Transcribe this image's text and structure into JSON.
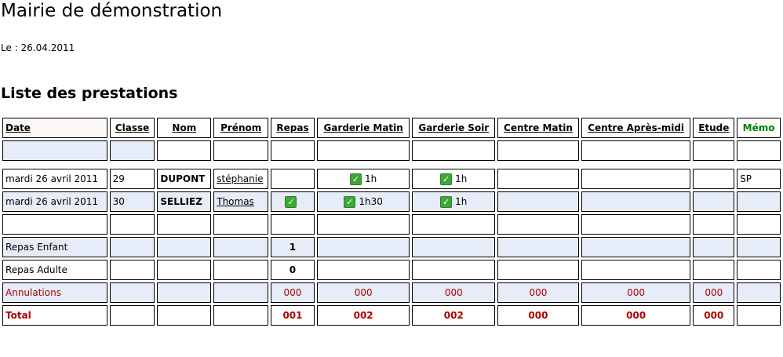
{
  "header": {
    "title": "Mairie de démonstration",
    "date_line": "Le : 26.04.2011",
    "subtitle": "Liste des prestations"
  },
  "table": {
    "columns": [
      "Date",
      "Classe",
      "Nom",
      "Prénom",
      "Repas",
      "Garderie Matin",
      "Garderie Soir",
      "Centre Matin",
      "Centre Après-midi",
      "Etude",
      "Mémo"
    ],
    "rows": [
      {
        "date": "mardi 26 avril 2011",
        "classe": "29",
        "nom": "DUPONT",
        "prenom": "stéphanie",
        "repas": "",
        "garderie_matin": "1h",
        "garderie_soir": "1h",
        "memo": "SP"
      },
      {
        "date": "mardi 26 avril 2011",
        "classe": "30",
        "nom": "SELLIEZ",
        "prenom": "Thomas",
        "repas": "check",
        "garderie_matin": "1h30",
        "garderie_soir": "1h",
        "memo": ""
      }
    ],
    "summary": {
      "repas_enfant_label": "Repas Enfant",
      "repas_enfant_value": "1",
      "repas_adulte_label": "Repas Adulte",
      "repas_adulte_value": "0",
      "annulations_label": "Annulations",
      "annulations": {
        "repas": "000",
        "garderie_matin": "000",
        "garderie_soir": "000",
        "centre_matin": "000",
        "centre_apres_midi": "000",
        "etude": "000"
      },
      "total_label": "Total",
      "total": {
        "repas": "001",
        "garderie_matin": "002",
        "garderie_soir": "002",
        "centre_matin": "000",
        "centre_apres_midi": "000",
        "etude": "000"
      }
    },
    "icons": {
      "check": "checkbox-checked-icon"
    },
    "colors": {
      "memo_header": "#008000",
      "annulations": "#b00000",
      "row_shade": "#e6ecf8"
    }
  }
}
